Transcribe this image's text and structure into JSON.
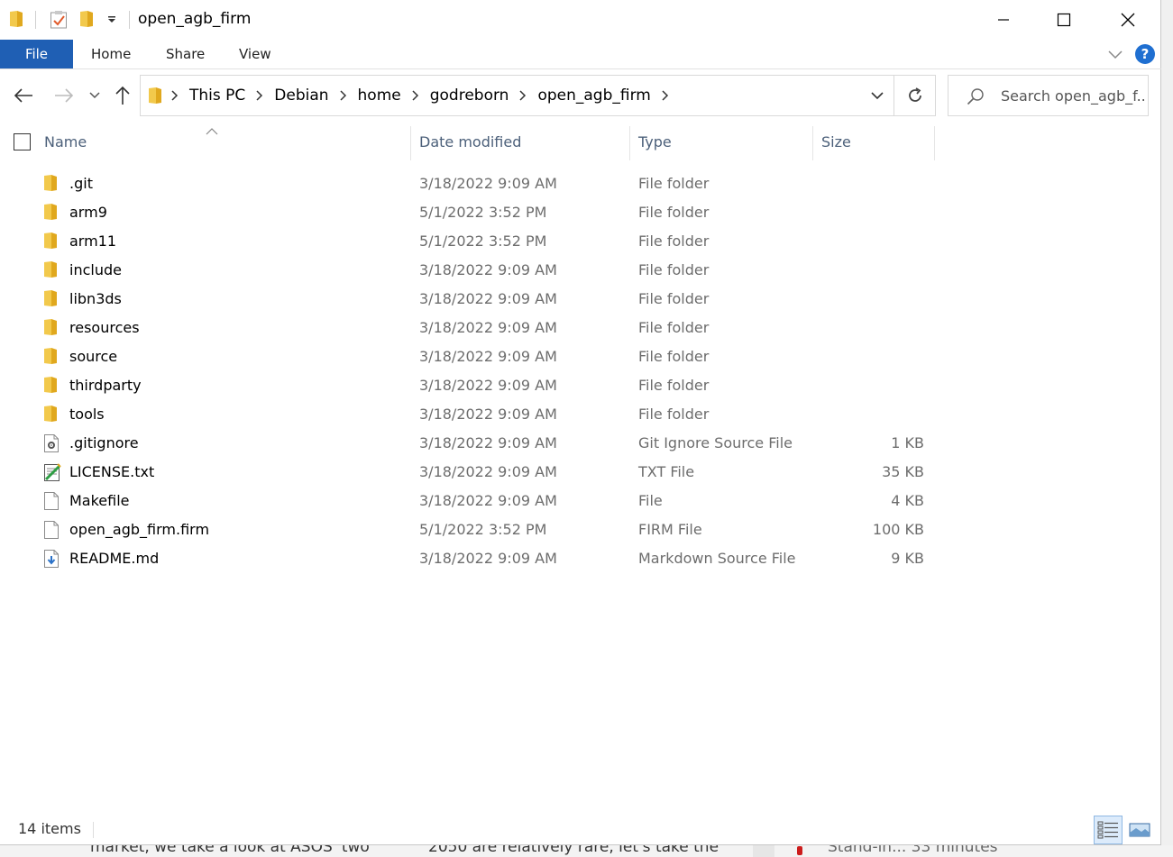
{
  "window": {
    "title": "open_agb_firm",
    "controls": {
      "minimize": "—",
      "maximize": "☐",
      "close": "✕"
    }
  },
  "ribbon": {
    "tabs": [
      {
        "label": "File",
        "active": true
      },
      {
        "label": "Home"
      },
      {
        "label": "Share"
      },
      {
        "label": "View"
      }
    ],
    "help": "?"
  },
  "address": {
    "crumbs": [
      "This PC",
      "Debian",
      "home",
      "godreborn",
      "open_agb_firm"
    ]
  },
  "search": {
    "placeholder": "Search open_agb_f..."
  },
  "columns": {
    "name": "Name",
    "date": "Date modified",
    "type": "Type",
    "size": "Size"
  },
  "files": [
    {
      "name": ".git",
      "date": "3/18/2022 9:09 AM",
      "type": "File folder",
      "size": "",
      "icon": "folder-icon"
    },
    {
      "name": "arm9",
      "date": "5/1/2022 3:52 PM",
      "type": "File folder",
      "size": "",
      "icon": "folder-icon"
    },
    {
      "name": "arm11",
      "date": "5/1/2022 3:52 PM",
      "type": "File folder",
      "size": "",
      "icon": "folder-icon"
    },
    {
      "name": "include",
      "date": "3/18/2022 9:09 AM",
      "type": "File folder",
      "size": "",
      "icon": "folder-icon"
    },
    {
      "name": "libn3ds",
      "date": "3/18/2022 9:09 AM",
      "type": "File folder",
      "size": "",
      "icon": "folder-icon"
    },
    {
      "name": "resources",
      "date": "3/18/2022 9:09 AM",
      "type": "File folder",
      "size": "",
      "icon": "folder-icon"
    },
    {
      "name": "source",
      "date": "3/18/2022 9:09 AM",
      "type": "File folder",
      "size": "",
      "icon": "folder-icon"
    },
    {
      "name": "thirdparty",
      "date": "3/18/2022 9:09 AM",
      "type": "File folder",
      "size": "",
      "icon": "folder-icon"
    },
    {
      "name": "tools",
      "date": "3/18/2022 9:09 AM",
      "type": "File folder",
      "size": "",
      "icon": "folder-icon"
    },
    {
      "name": ".gitignore",
      "date": "3/18/2022 9:09 AM",
      "type": "Git Ignore Source File",
      "size": "1 KB",
      "icon": "config-file-icon"
    },
    {
      "name": "LICENSE.txt",
      "date": "3/18/2022 9:09 AM",
      "type": "TXT File",
      "size": "35 KB",
      "icon": "text-file-icon"
    },
    {
      "name": "Makefile",
      "date": "3/18/2022 9:09 AM",
      "type": "File",
      "size": "4 KB",
      "icon": "blank-file-icon"
    },
    {
      "name": "open_agb_firm.firm",
      "date": "5/1/2022 3:52 PM",
      "type": "FIRM File",
      "size": "100 KB",
      "icon": "blank-file-icon"
    },
    {
      "name": "README.md",
      "date": "3/18/2022 9:09 AM",
      "type": "Markdown Source File",
      "size": "9 KB",
      "icon": "markdown-file-icon"
    }
  ],
  "status": {
    "item_count": "14 items"
  },
  "background_fragments": {
    "left": "market, we take a look at ASOS' two",
    "middle": "2050 are relatively rare, let's take the",
    "right": "Stand-in... 33 minutes"
  },
  "colors": {
    "accent": "#1f5fb4",
    "folder": "#f2c94c",
    "header_text": "#4c607a",
    "secondary_text": "#6d6d6d"
  }
}
